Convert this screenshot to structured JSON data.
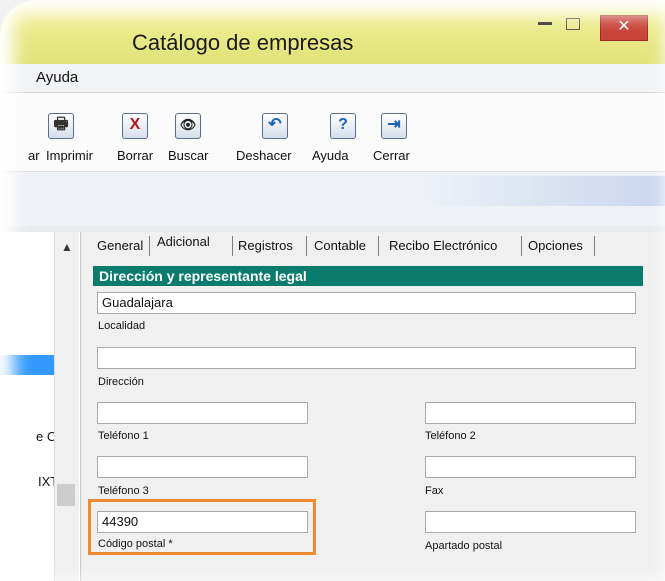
{
  "window": {
    "title": "Catálogo de empresas",
    "close_glyph": "✕"
  },
  "menu": {
    "items": [
      "Ayuda"
    ]
  },
  "toolbar": {
    "buttons": [
      {
        "label": "ar",
        "icon": "save-icon",
        "glyph": ""
      },
      {
        "label": "Imprimir",
        "icon": "printer-icon",
        "glyph": "🖶"
      },
      {
        "label": "Borrar",
        "icon": "delete-x-icon",
        "glyph": "X"
      },
      {
        "label": "Buscar",
        "icon": "binoculars-icon",
        "glyph": "👁"
      },
      {
        "label": "Deshacer",
        "icon": "undo-icon",
        "glyph": "↶"
      },
      {
        "label": "Ayuda",
        "icon": "help-icon",
        "glyph": "?"
      },
      {
        "label": "Cerrar",
        "icon": "exit-icon",
        "glyph": "⇥"
      }
    ]
  },
  "left_list": {
    "items": [
      "e C.\\",
      "IXT"
    ],
    "selected_index": 1
  },
  "tabs": [
    "General",
    "Adicional",
    "Registros",
    "Contable",
    "Recibo Electrónico",
    "Opciones"
  ],
  "active_tab": "Adicional",
  "section": {
    "title": "Dirección y representante legal"
  },
  "fields": {
    "localidad": {
      "value": "Guadalajara",
      "label": "Localidad"
    },
    "direccion": {
      "value": "",
      "label": "Dirección"
    },
    "telefono1": {
      "value": "",
      "label": "Teléfono 1"
    },
    "telefono2": {
      "value": "",
      "label": "Teléfono 2"
    },
    "telefono3": {
      "value": "",
      "label": "Teléfono 3"
    },
    "fax": {
      "value": "",
      "label": "Fax"
    },
    "codigo_postal": {
      "value": "44390",
      "label": "Código postal",
      "required_mark": "*"
    },
    "apartado_postal": {
      "value": "",
      "label": "Apartado postal"
    }
  },
  "colors": {
    "title_bar": "#e8e88a",
    "section_header": "#0a7c6e",
    "highlight": "#f08a30",
    "selection": "#3399ff"
  }
}
